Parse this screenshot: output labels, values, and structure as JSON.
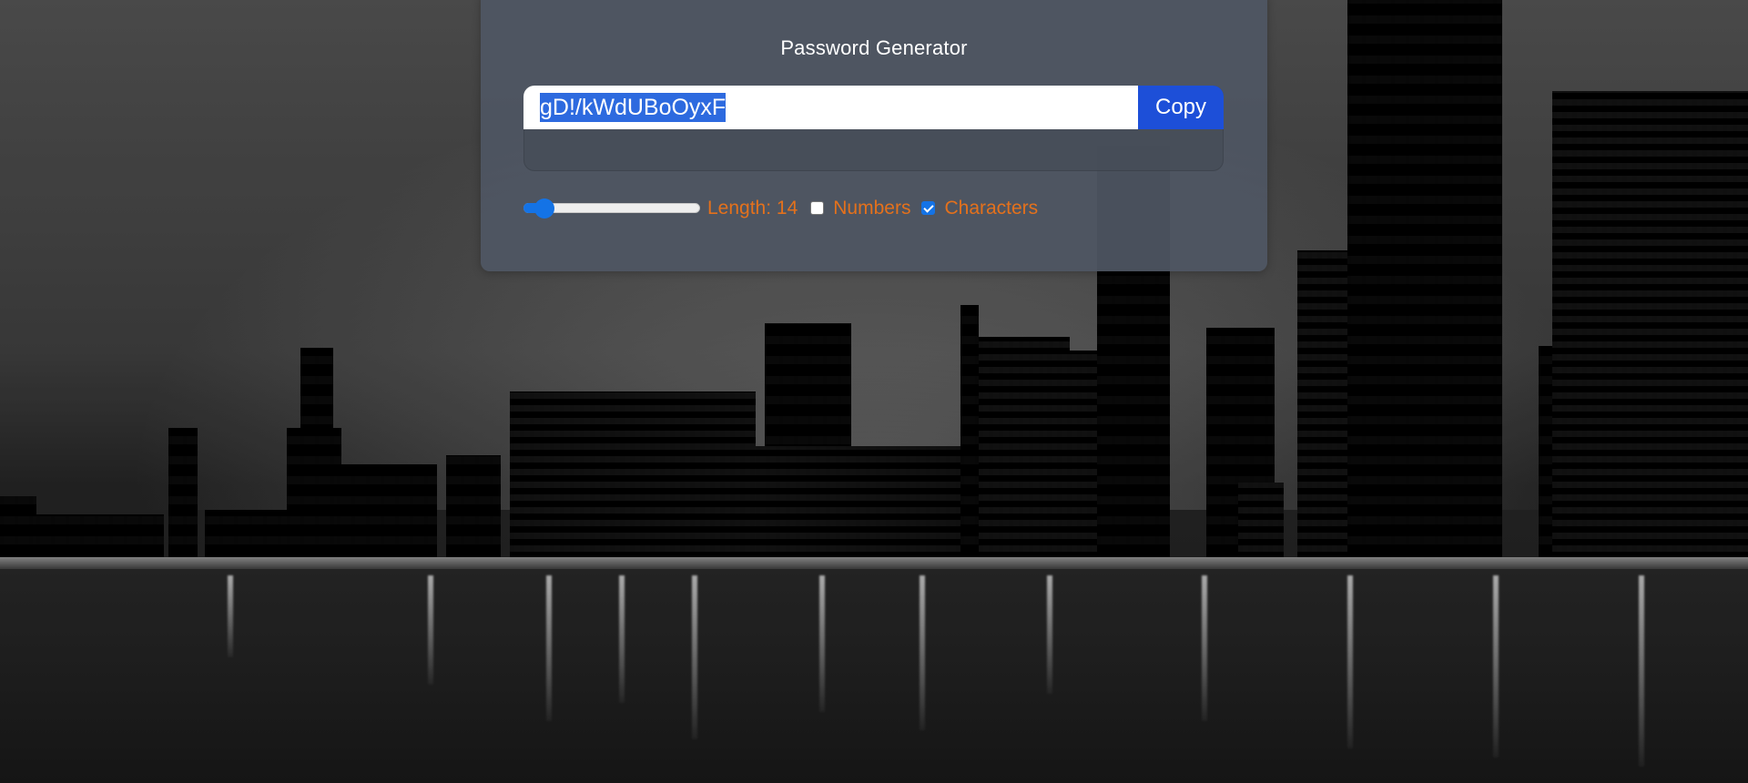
{
  "app": {
    "title": "Password Generator"
  },
  "password": {
    "value": "gD!/kWdUBoOyxF",
    "selected": true
  },
  "copy_button": {
    "label": "Copy"
  },
  "length_slider": {
    "label": "Length: 14",
    "value": 14,
    "fill_fraction": 0.12
  },
  "options": {
    "numbers": {
      "label": "Numbers",
      "checked": false
    },
    "characters": {
      "label": "Characters",
      "checked": true
    }
  },
  "colors": {
    "card": "#4f5663",
    "accent": "#1d4fd8",
    "label_text": "#e4711c",
    "selection": "#2d6adf"
  },
  "icons": {
    "background": "city-skyline-night-photo"
  }
}
